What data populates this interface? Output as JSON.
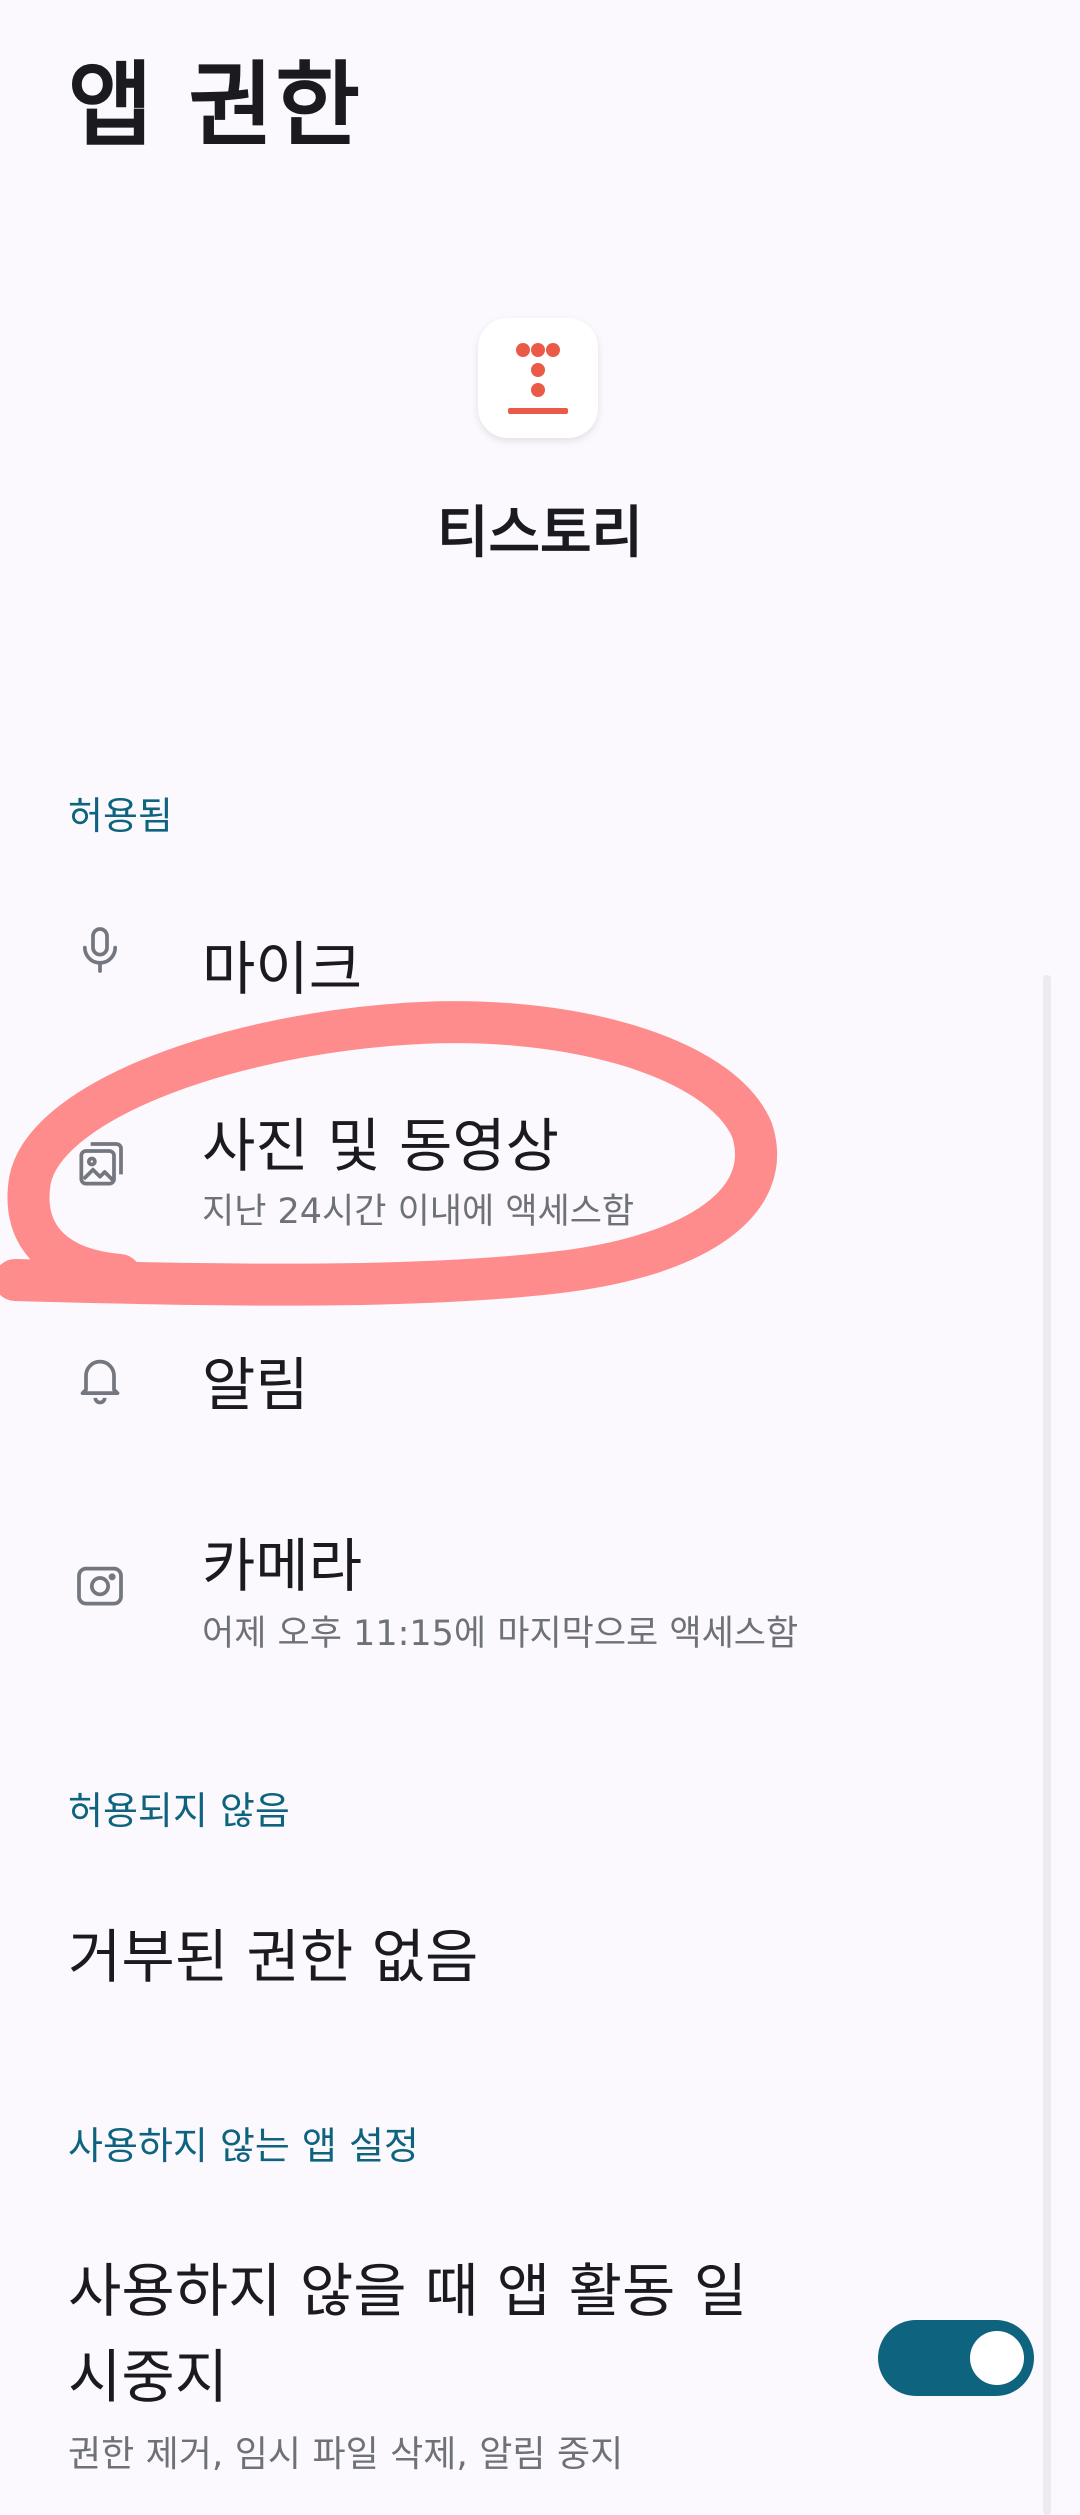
{
  "header": {
    "title": "앱 권한"
  },
  "app": {
    "name": "티스토리",
    "icon": "tistory-logo",
    "accent": "#eb5a46"
  },
  "allowed": {
    "header": "허용됨",
    "items": [
      {
        "title": "마이크",
        "subtitle": "",
        "icon": "microphone-icon"
      },
      {
        "title": "사진 및 동영상",
        "subtitle": "지난 24시간 이내에 액세스함",
        "icon": "photos-icon"
      },
      {
        "title": "알림",
        "subtitle": "",
        "icon": "bell-icon"
      },
      {
        "title": "카메라",
        "subtitle": "어제 오후 11:15에 마지막으로 액세스함",
        "icon": "camera-icon"
      }
    ]
  },
  "denied": {
    "header": "허용되지 않음",
    "empty_text": "거부된 권한 없음"
  },
  "unused": {
    "header": "사용하지 않는 앱 설정",
    "pause_title": "사용하지 않을 때 앱 활동 일시중지",
    "pause_subtitle": "권한 제거, 임시 파일 삭제, 알림 중지",
    "toggle_on": true
  },
  "colors": {
    "accent": "#0e637f",
    "annotation": "#ff8080",
    "background": "#fbf9fd"
  }
}
